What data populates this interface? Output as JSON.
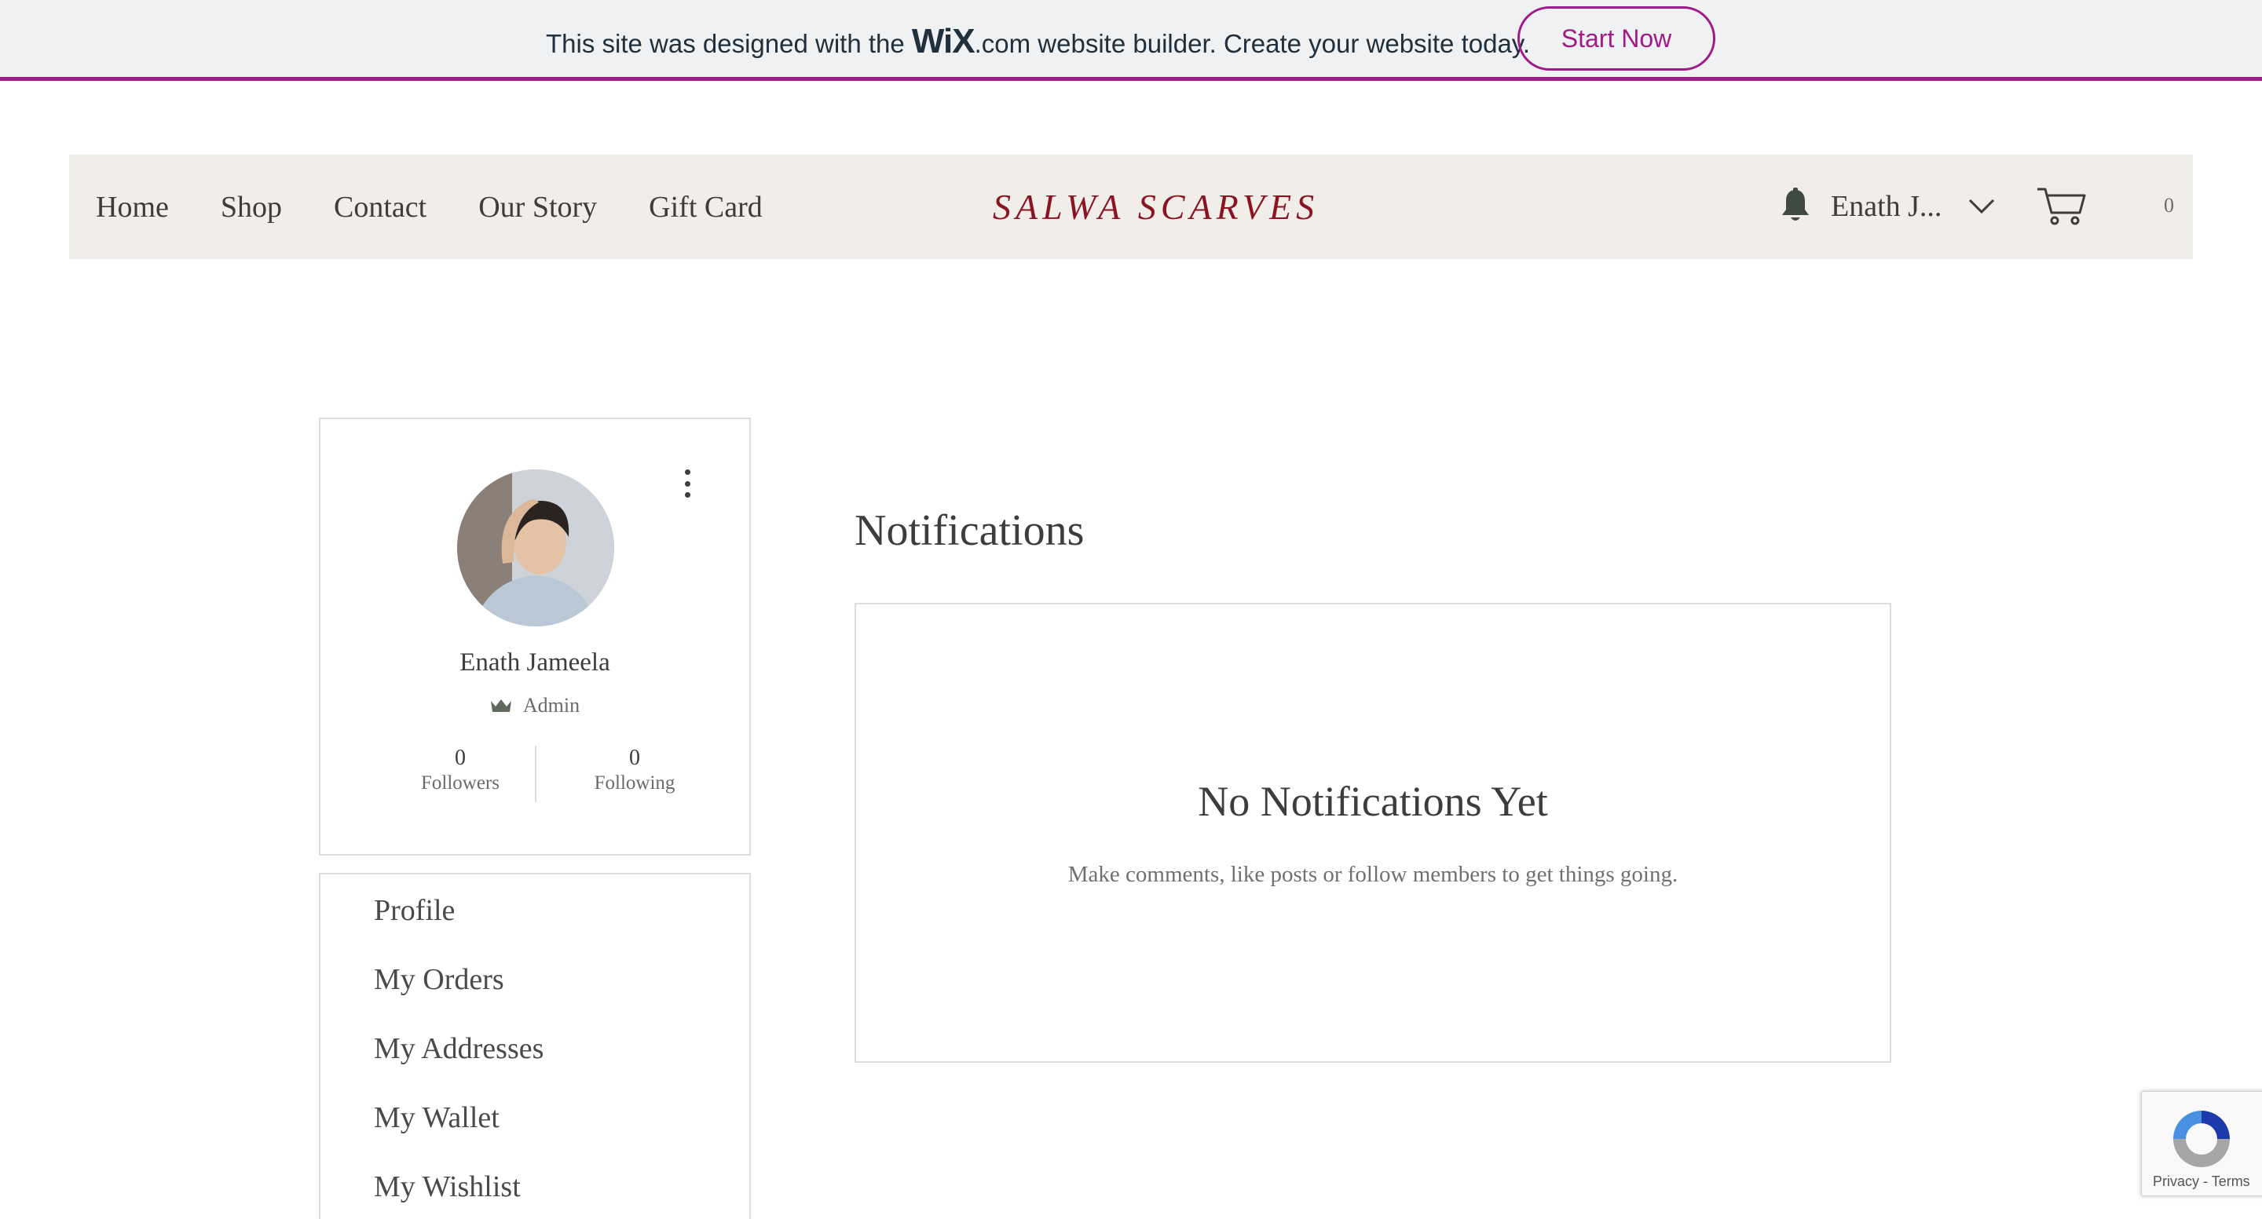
{
  "banner": {
    "text_before": "This site was designed with the ",
    "logo": "WiX",
    "text_after": ".com website builder. Create your website today.",
    "cta": "Start Now",
    "accent_color": "#a01a88"
  },
  "header": {
    "nav": [
      "Home",
      "Shop",
      "Contact",
      "Our Story",
      "Gift Card"
    ],
    "brand": "SALWA SCARVES",
    "brand_color": "#8b1422",
    "user_name": "Enath J...",
    "cart_count": "0",
    "icons": [
      "bell-icon",
      "chevron-down-icon",
      "cart-icon"
    ]
  },
  "profile": {
    "name": "Enath Jameela",
    "role": "Admin",
    "followers_count": "0",
    "followers_label": "Followers",
    "following_count": "0",
    "following_label": "Following"
  },
  "menu": {
    "items": [
      "Profile",
      "My Orders",
      "My Addresses",
      "My Wallet",
      "My Wishlist"
    ]
  },
  "notifications": {
    "title": "Notifications",
    "empty_title": "No Notifications Yet",
    "empty_subtitle": "Make comments, like posts or follow members to get things going."
  },
  "recaptcha": {
    "privacy": "Privacy",
    "separator": " - ",
    "terms": "Terms"
  }
}
